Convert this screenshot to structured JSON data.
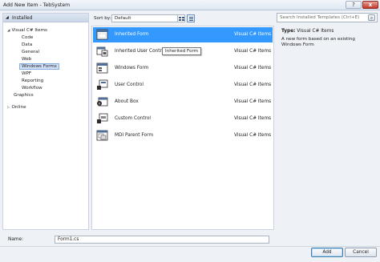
{
  "window": {
    "title": "Add New Item - TebSystem",
    "help_label": "?",
    "close_label": "x"
  },
  "tree": {
    "header": "Installed",
    "nodes": [
      {
        "label": "Visual C# Items",
        "expanded": true
      },
      {
        "label": "Code"
      },
      {
        "label": "Data"
      },
      {
        "label": "General"
      },
      {
        "label": "Web"
      },
      {
        "label": "Windows Forms",
        "selected": true
      },
      {
        "label": "WPF"
      },
      {
        "label": "Reporting"
      },
      {
        "label": "Workflow"
      },
      {
        "label": "Graphics"
      },
      {
        "label": "Online",
        "collapsed": true
      }
    ]
  },
  "sort": {
    "label": "Sort by:",
    "value": "Default"
  },
  "templates": [
    {
      "name": "Inherited Form",
      "lang": "Visual C# Items",
      "icon": "inherited-form-icon",
      "selected": true
    },
    {
      "name": "Inherited User Control",
      "lang": "Visual C# Items",
      "icon": "inherited-user-control-icon"
    },
    {
      "name": "Windows Form",
      "lang": "Visual C# Items",
      "icon": "windows-form-icon"
    },
    {
      "name": "User Control",
      "lang": "Visual C# Items",
      "icon": "user-control-icon"
    },
    {
      "name": "About Box",
      "lang": "Visual C# Items",
      "icon": "about-box-icon"
    },
    {
      "name": "Custom Control",
      "lang": "Visual C# Items",
      "icon": "custom-control-icon"
    },
    {
      "name": "MDI Parent Form",
      "lang": "Visual C# Items",
      "icon": "mdi-parent-form-icon"
    }
  ],
  "tooltip": "Inherited Form",
  "search": {
    "placeholder": "Search Installed Templates (Ctrl+E)"
  },
  "detail": {
    "type_label": "Type:",
    "type_value": "Visual C# Items",
    "description": "A new form based on an existing Windows Form"
  },
  "name_field": {
    "label": "Name:",
    "value": "Form1.cs"
  },
  "buttons": {
    "add": "Add",
    "cancel": "Cancel"
  },
  "colors": {
    "selection": "#3399ff",
    "tree_selection": "#cfe0f7"
  }
}
